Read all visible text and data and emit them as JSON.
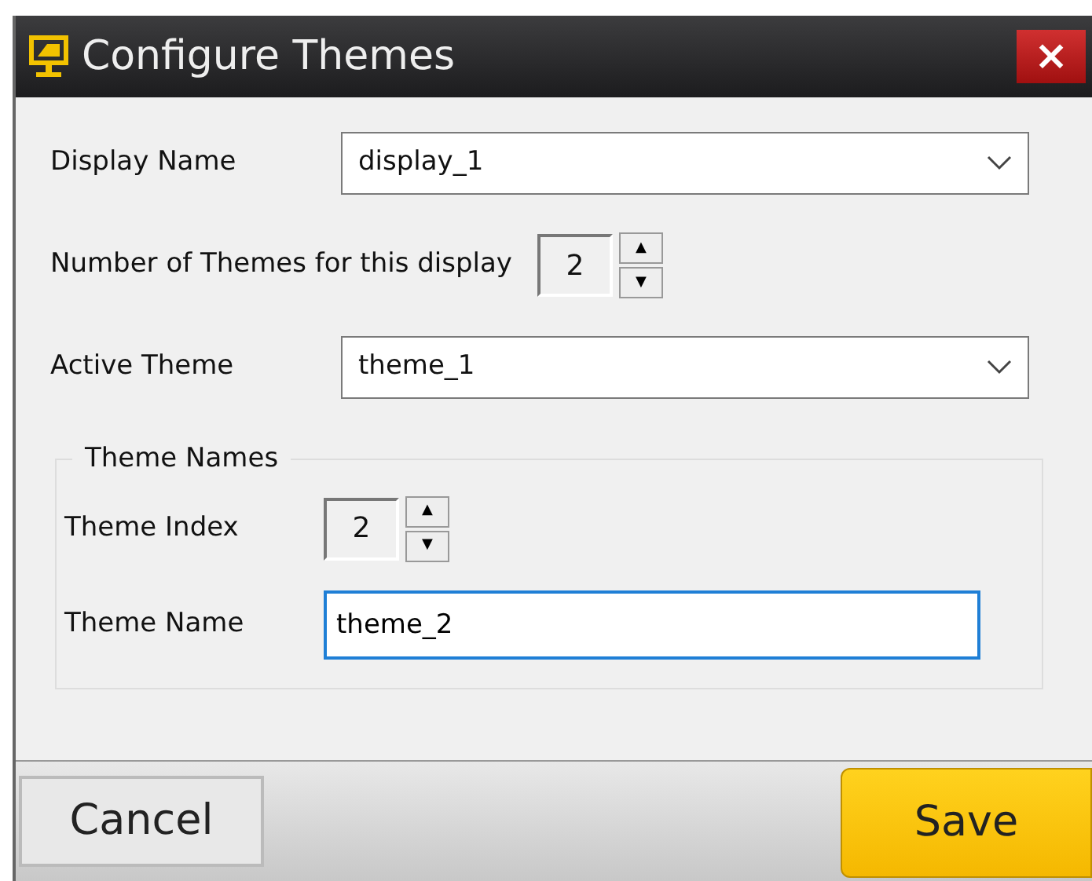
{
  "window": {
    "title": "Configure Themes",
    "close": "×"
  },
  "display_name": {
    "label": "Display Name",
    "value": "display_1"
  },
  "theme_count": {
    "label": "Number of Themes for this display",
    "value": "2",
    "up": "▲",
    "down": "▼"
  },
  "active_theme": {
    "label": "Active Theme",
    "value": "theme_1"
  },
  "theme_names": {
    "legend": "Theme Names",
    "index": {
      "label": "Theme Index",
      "value": "2",
      "up": "▲",
      "down": "▼"
    },
    "name": {
      "label": "Theme Name",
      "value": "theme_2",
      "focused": true
    }
  },
  "buttons": [
    {
      "label": "Cancel",
      "kind": "plain"
    },
    {
      "label": "Save",
      "kind": "primary"
    }
  ]
}
